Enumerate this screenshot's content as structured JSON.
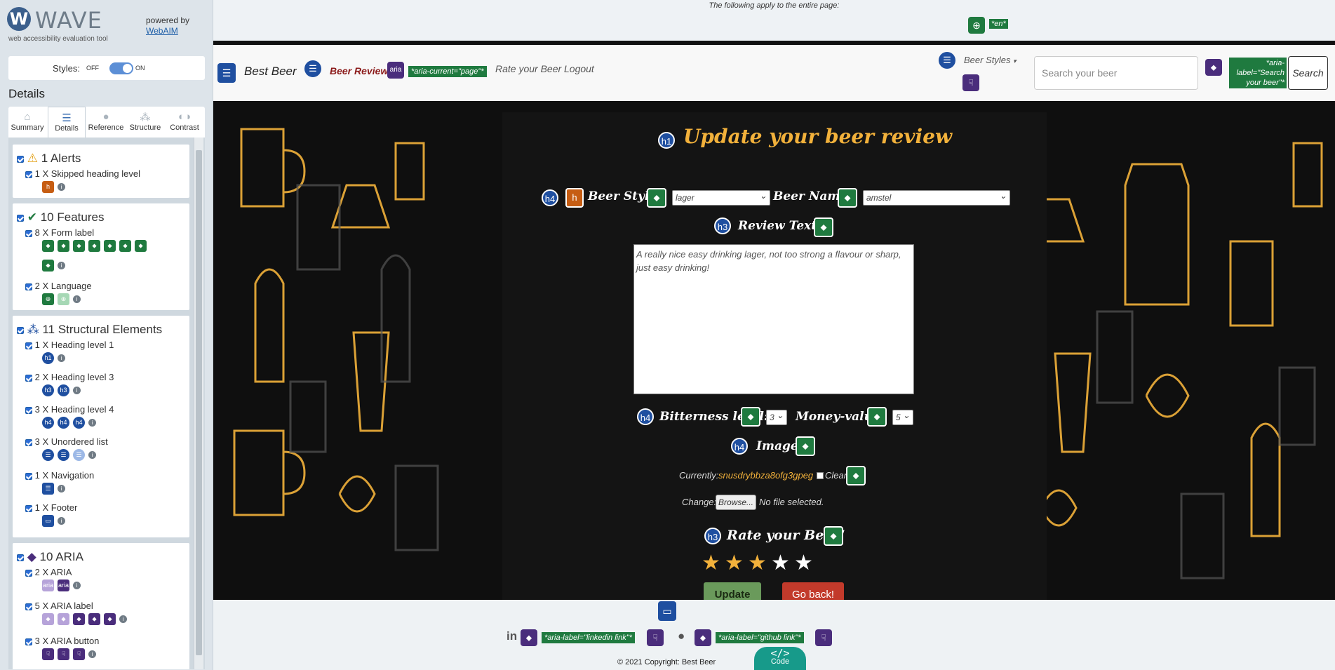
{
  "sidebar": {
    "brand": "WAVE",
    "brand_sub": "web accessibility evaluation tool",
    "powered_by": "powered by",
    "webaim": "WebAIM",
    "styles_label": "Styles:",
    "styles_off": "OFF",
    "styles_on": "ON",
    "details_heading": "Details",
    "tabs": [
      "Summary",
      "Details",
      "Reference",
      "Structure",
      "Contrast"
    ],
    "sections": {
      "alerts": {
        "title": "1 Alerts",
        "items": [
          "1 X Skipped heading level"
        ]
      },
      "features": {
        "title": "10 Features",
        "items": [
          "8 X Form label",
          "2 X Language"
        ]
      },
      "structural": {
        "title": "11 Structural Elements",
        "items": [
          "1 X Heading level 1",
          "2 X Heading level 3",
          "3 X Heading level 4",
          "3 X Unordered list",
          "1 X Navigation",
          "1 X Footer"
        ]
      },
      "aria": {
        "title": "10 ARIA",
        "items": [
          "2 X ARIA",
          "5 X ARIA label",
          "3 X ARIA button"
        ]
      }
    }
  },
  "pagebar": {
    "text": "The following apply to the entire page:",
    "lang_tag": "*en*"
  },
  "nav": {
    "brand": "Best Beer",
    "links": [
      "Beer Reviews",
      "Rate your Beer",
      "Logout"
    ],
    "aria_current_tag": "*aria-current=\"page\"*",
    "aria_icon_text": "aria",
    "dropdown": "Beer Styles",
    "search_placeholder": "Search your beer",
    "search_aria_tag": "*aria-label=\"Search your beer\"*",
    "search_button": "Search"
  },
  "form": {
    "title": "Update your beer review",
    "beer_style_label": "Beer Style:",
    "beer_style_value": "lager",
    "beer_name_label": "Beer Name:",
    "beer_name_value": "amstel",
    "review_label": "Review Text:",
    "review_text": "A really nice easy drinking lager, not too strong a flavour or sharp, just easy drinking!",
    "bitterness_label": "Bitterness level:",
    "bitterness_value": "3",
    "money_label": "Money-value:",
    "money_value": "5",
    "image_label": "Image:",
    "currently_label": "Currently:",
    "currently_file": "snusdrybbza8ofg3gpeg",
    "clear_label": "Clear",
    "change_label": "Change:",
    "browse_button": "Browse...",
    "no_file": "No file selected.",
    "rate_heading": "Rate your Beer!",
    "rating": 3,
    "rating_max": 5,
    "update_button": "Update",
    "back_button": "Go back!"
  },
  "footer": {
    "linkedin_tag": "*aria-label=\"linkedin link\"*",
    "github_tag": "*aria-label=\"github link\"*",
    "copyright": "© 2021 Copyright: Best Beer",
    "code_tab": "Code"
  },
  "colors": {
    "accent_yellow": "#f2b13b",
    "wave_green": "#1f7a3f",
    "wave_blue": "#1f4fa0",
    "wave_purple": "#4a2d7c",
    "update_green": "#6a9a5b",
    "back_red": "#c23a2b"
  }
}
